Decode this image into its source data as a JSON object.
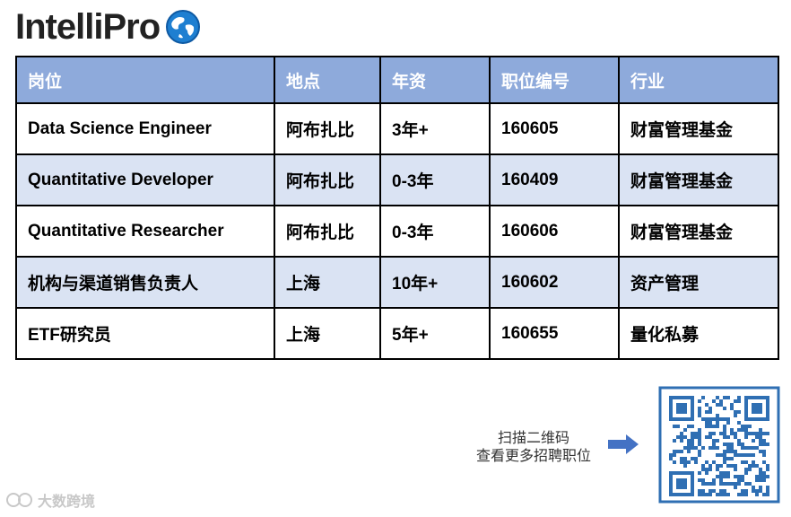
{
  "brand": {
    "logo_text": "IntelliPro",
    "globe": "globe-icon"
  },
  "table": {
    "headers": [
      "岗位",
      "地点",
      "年资",
      "职位编号",
      "行业"
    ],
    "rows": [
      [
        "Data Science Engineer",
        "阿布扎比",
        "3年+",
        "160605",
        "财富管理基金"
      ],
      [
        "Quantitative Developer",
        "阿布扎比",
        "0-3年",
        "160409",
        "财富管理基金"
      ],
      [
        "Quantitative Researcher",
        "阿布扎比",
        "0-3年",
        "160606",
        "财富管理基金"
      ],
      [
        "机构与渠道销售负责人",
        "上海",
        "10年+",
        "160602",
        "资产管理"
      ],
      [
        "ETF研究员",
        "上海",
        "5年+",
        "160655",
        "量化私募"
      ]
    ]
  },
  "cta": {
    "line1": "扫描二维码",
    "line2": "查看更多招聘职位"
  },
  "icons": {
    "arrow": "arrow-right-icon",
    "qr": "qr-code-icon"
  },
  "watermark": {
    "text": "大数跨境"
  },
  "colors": {
    "header_bg": "#8eaadb",
    "alt_row_bg": "#dae3f3",
    "arrow": "#4472c4",
    "qr": "#2f6fb3"
  }
}
